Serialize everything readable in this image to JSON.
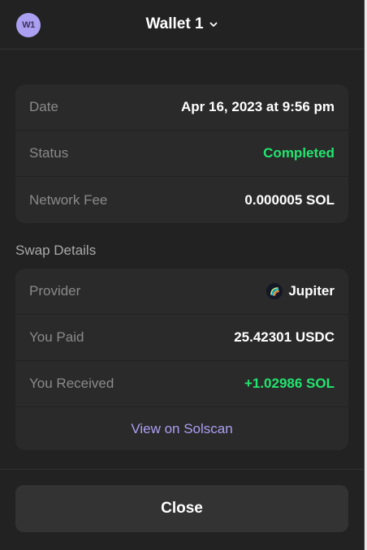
{
  "header": {
    "avatar_initials": "W1",
    "wallet_name": "Wallet 1",
    "accent_color": "#ab9ff2"
  },
  "summary": {
    "rows": [
      {
        "label": "Date",
        "value": "Apr 16, 2023 at 9:56 pm"
      },
      {
        "label": "Status",
        "value": "Completed"
      },
      {
        "label": "Network Fee",
        "value": "0.000005 SOL"
      }
    ]
  },
  "swap": {
    "title": "Swap Details",
    "rows": [
      {
        "label": "Provider",
        "value": "Jupiter",
        "icon": "jupiter-logo-icon"
      },
      {
        "label": "You Paid",
        "value": "25.42301 USDC"
      },
      {
        "label": "You Received",
        "value": "+1.02986 SOL"
      }
    ],
    "link_label": "View on Solscan"
  },
  "footer": {
    "close_label": "Close"
  },
  "colors": {
    "background": "#222222",
    "card": "#2a2a2a",
    "success": "#21e56f",
    "link": "#ab9ff2"
  }
}
